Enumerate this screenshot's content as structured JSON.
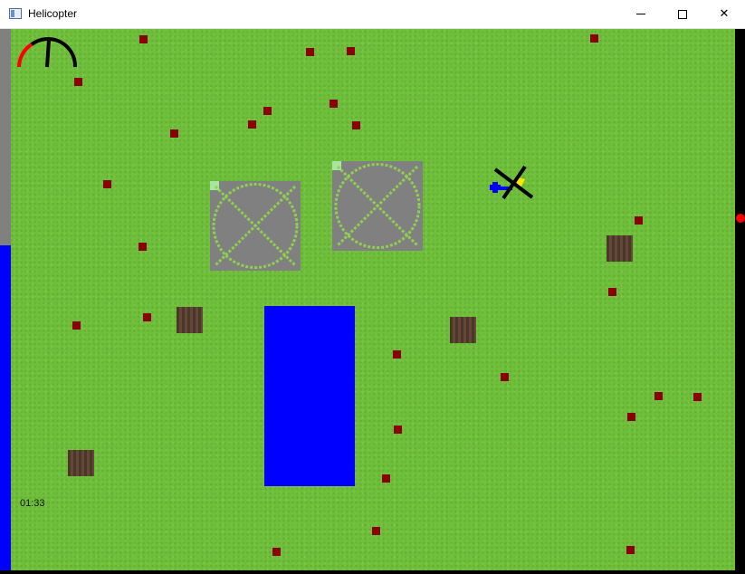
{
  "window": {
    "title": "Helicopter",
    "controls": {
      "minimize": "minimize",
      "maximize": "maximize",
      "close": "✕"
    }
  },
  "hud": {
    "timer": "01:33",
    "fuel_fraction": 0.6,
    "colors": {
      "fuel": "#0000ff",
      "gauge_warning": "#ff0000",
      "gauge_normal": "#000000",
      "marker": "#ff0000"
    }
  },
  "scene": {
    "colors": {
      "grass": "#6fbf3a",
      "enemy": "#8b0000",
      "lake": "#0000ff",
      "pad": "#808080",
      "crate": "#5a3e2e"
    },
    "icons": [
      "helicopter-icon",
      "speed-gauge-icon",
      "landing-pad-icon",
      "crate-icon",
      "enemy-marker-icon"
    ]
  }
}
